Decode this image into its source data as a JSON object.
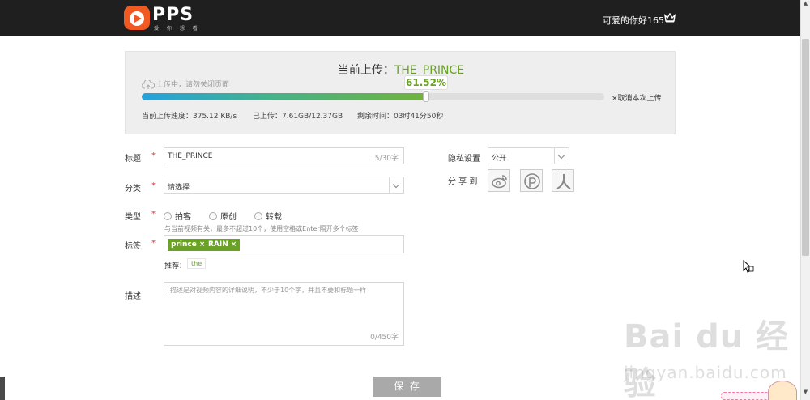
{
  "header": {
    "logo_text": "PPS",
    "logo_sub": "爱 你 想 看",
    "user_name": "可爱的你好165"
  },
  "upload": {
    "title_prefix": "当前上传：",
    "file_name": "THE_PRINCE",
    "hint": "上传中，请勿关闭页面",
    "percent_text": "61.52%",
    "progress": 0.6152,
    "cancel": "×取消本次上传",
    "speed": "当前上传速度：375.12 KB/s",
    "uploaded": "已上传：7.61GB/12.37GB",
    "remaining": "剩余时间：03时41分50秒"
  },
  "form": {
    "title_label": "标题",
    "title_value": "THE_PRINCE",
    "title_count": "5/30字",
    "category_label": "分类",
    "category_value": "请选择",
    "type_label": "类型",
    "type_options": [
      "拍客",
      "原创",
      "转载"
    ],
    "tags_label": "标签",
    "tags_hint": "与当前视频有关，最多不超过10个，使用空格或Enter隔开多个标签",
    "tags": [
      "prince",
      "RAIN"
    ],
    "recommend_label": "推荐：",
    "recommend_tags": [
      "the"
    ],
    "desc_label": "描述",
    "desc_placeholder": "描述是对视频内容的详细说明，不少于10个字，并且不要和标题一样",
    "desc_count": "0/450字",
    "required_mark": "*",
    "privacy_label": "隐私设置",
    "privacy_value": "公开",
    "share_label": "分 享 到",
    "share_targets": [
      "weibo-icon",
      "qzone-icon",
      "renren-icon"
    ],
    "save_label": "保 存"
  },
  "watermark": {
    "text": "Bai du 经验",
    "url": "jingyan.baidu.com"
  },
  "colors": {
    "accent_green": "#6aa127",
    "brand_orange": "#f05a22",
    "header_bg": "#1f1f1f"
  }
}
